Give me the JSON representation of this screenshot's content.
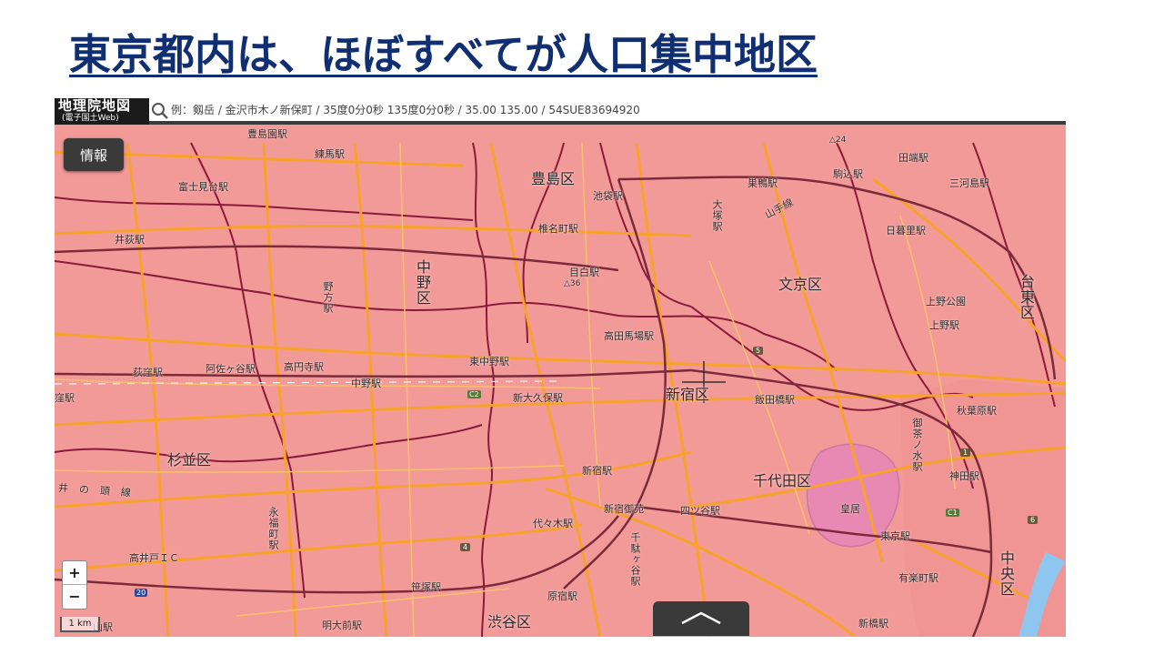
{
  "slide_title": "東京都内は、ほぼすべてが人口集中地区",
  "app": {
    "logo_main": "地理院地図",
    "logo_sub": "(電子国土Web)",
    "search_placeholder": "例：剱岳 / 金沢市木ノ新保町 / 35度0分0秒 135度0分0秒 / 35.00 135.00 / 54SUE83694920",
    "info_button": "情報",
    "zoom_in": "+",
    "zoom_out": "−",
    "scale_label": "1 km",
    "footer_toggle_icon": "chevron-up-icon"
  },
  "map": {
    "colors": {
      "did_area": "#f29a98",
      "major_road": "#f7a22a",
      "rail_line": "#7a2a3a",
      "boundary": "#8a1a3a",
      "palace_area": "#e889b4"
    },
    "wards": {
      "toshima": "豊島区",
      "nakano": "中野区",
      "bunkyo": "文京区",
      "taito": "台東区",
      "shinjuku": "新宿区",
      "suginami": "杉並区",
      "chiyoda": "千代田区",
      "chuo": "中央区",
      "shibuya": "渋谷区"
    },
    "stations": {
      "toshimaen": "豊島園駅",
      "nerima": "練馬駅",
      "fujimidai": "富士見台駅",
      "ikebukuro": "池袋駅",
      "sugamo": "巣鴨駅",
      "komagome": "駒込駅",
      "tabata": "田端駅",
      "mikawashima": "三河島駅",
      "ogikubo_tq": "井荻駅",
      "shiinamachi": "椎名町駅",
      "otsuka": "大塚駅",
      "yamanote": "山手線",
      "nippori": "日暮里駅",
      "mejiro": "目白駅",
      "nogata": "野方駅",
      "uenokoen": "上野公園",
      "ueno": "上野駅",
      "takadanobaba": "高田馬場駅",
      "higashinakano": "東中野駅",
      "ogikubo": "荻窪駅",
      "asagaya": "阿佐ヶ谷駅",
      "koenji": "高円寺駅",
      "nakano": "中野駅",
      "shinokubo": "新大久保駅",
      "iidabashi": "飯田橋駅",
      "akihabara": "秋葉原駅",
      "nishiogikubo": "窪駅",
      "ochanomizu": "御茶ノ水駅",
      "shinjuku": "新宿駅",
      "kanda": "神田駅",
      "inokashira": "井の頭線",
      "shinjukugyoen": "新宿御苑",
      "yotsuya": "四ツ谷駅",
      "kokyo": "皇居",
      "yoyogi": "代々木駅",
      "eifukucho": "永福町駅",
      "sendagaya": "千駄ヶ谷駅",
      "tokyo": "東京駅",
      "takaido": "高井戸ＩＣ",
      "yurakucho": "有楽町駅",
      "sasazuka": "笹塚駅",
      "harajuku": "原宿駅",
      "meidaimae": "明大前駅",
      "shinbashi": "新橋駅",
      "fujimigaoka": "山駅"
    },
    "elevations": {
      "e24": "24",
      "e36": "36"
    },
    "route_shields": {
      "r5": "5",
      "c2": "C2",
      "c1": "C1",
      "r4": "4",
      "r6": "6",
      "r20": "20",
      "r1": "1"
    }
  }
}
